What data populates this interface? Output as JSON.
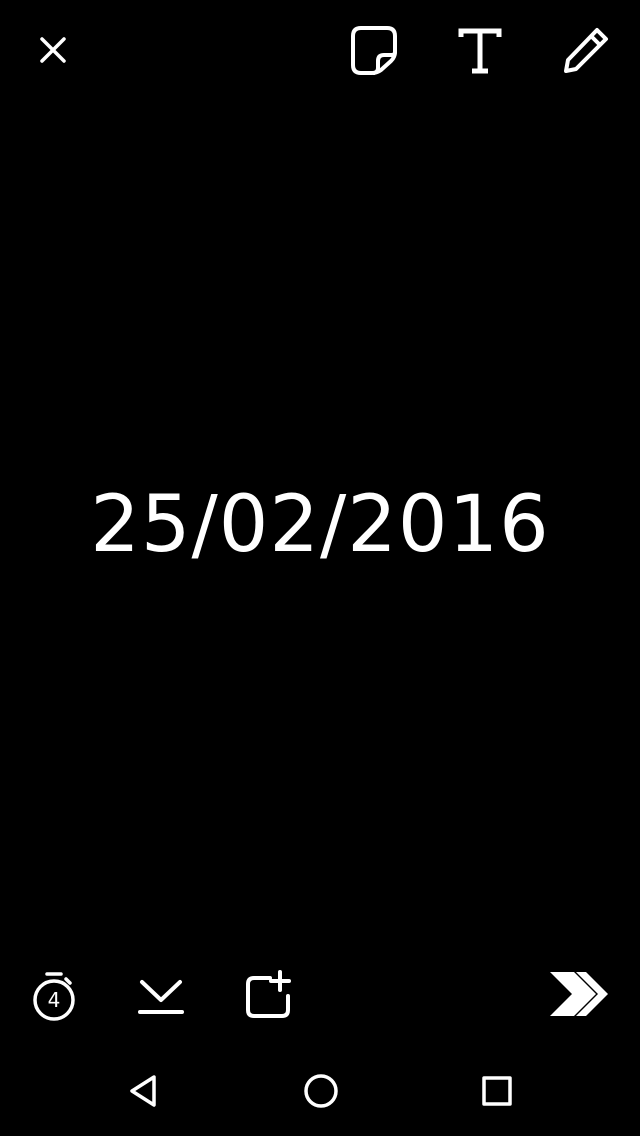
{
  "top_toolbar": {
    "close_icon": "close-icon",
    "sticker_icon": "sticker-icon",
    "text_tool_label": "T",
    "pencil_icon": "pencil-icon"
  },
  "canvas": {
    "caption_text": "25/02/2016"
  },
  "bottom_toolbar": {
    "timer_seconds": "4",
    "timer_icon": "timer-icon",
    "download_icon": "download-icon",
    "add_to_story_icon": "add-to-story-icon",
    "send_icon": "send-arrow-icon"
  },
  "nav_bar": {
    "back_icon": "triangle-back-icon",
    "home_icon": "circle-home-icon",
    "recents_icon": "square-recents-icon"
  },
  "colors": {
    "background": "#000000",
    "foreground": "#ffffff"
  }
}
